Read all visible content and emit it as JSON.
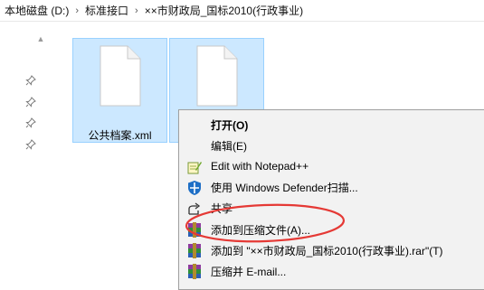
{
  "breadcrumb": {
    "items": [
      "本地磁盘 (D:)",
      "标准接口",
      "××市财政局_国标2010(行政事业)"
    ],
    "separator": "›"
  },
  "files": [
    {
      "name": "公共档案.xml",
      "icon": "document-icon"
    },
    {
      "name": "",
      "icon": "document-icon"
    }
  ],
  "quick_access_pins": [
    "pin-icon",
    "pin-icon",
    "pin-icon",
    "pin-icon"
  ],
  "context_menu": {
    "items": [
      {
        "label": "打开(O)",
        "icon": "",
        "bold": true
      },
      {
        "label": "编辑(E)",
        "icon": ""
      },
      {
        "label": "Edit with Notepad++",
        "icon": "notepad-plus-plus-icon"
      },
      {
        "label": "使用 Windows Defender扫描...",
        "icon": "windows-defender-shield-icon"
      },
      {
        "label": "共享",
        "icon": "share-icon"
      },
      {
        "label": "添加到压缩文件(A)...",
        "icon": "winrar-icon"
      },
      {
        "label": "添加到 \"××市财政局_国标2010(行政事业).rar\"(T)",
        "icon": "winrar-icon"
      },
      {
        "label": "压缩并 E-mail...",
        "icon": "winrar-icon"
      }
    ]
  },
  "colors": {
    "selection_fill": "#cce8ff",
    "selection_border": "#99d1ff",
    "menu_background": "#f2f2f2",
    "annotation": "#e53935"
  }
}
